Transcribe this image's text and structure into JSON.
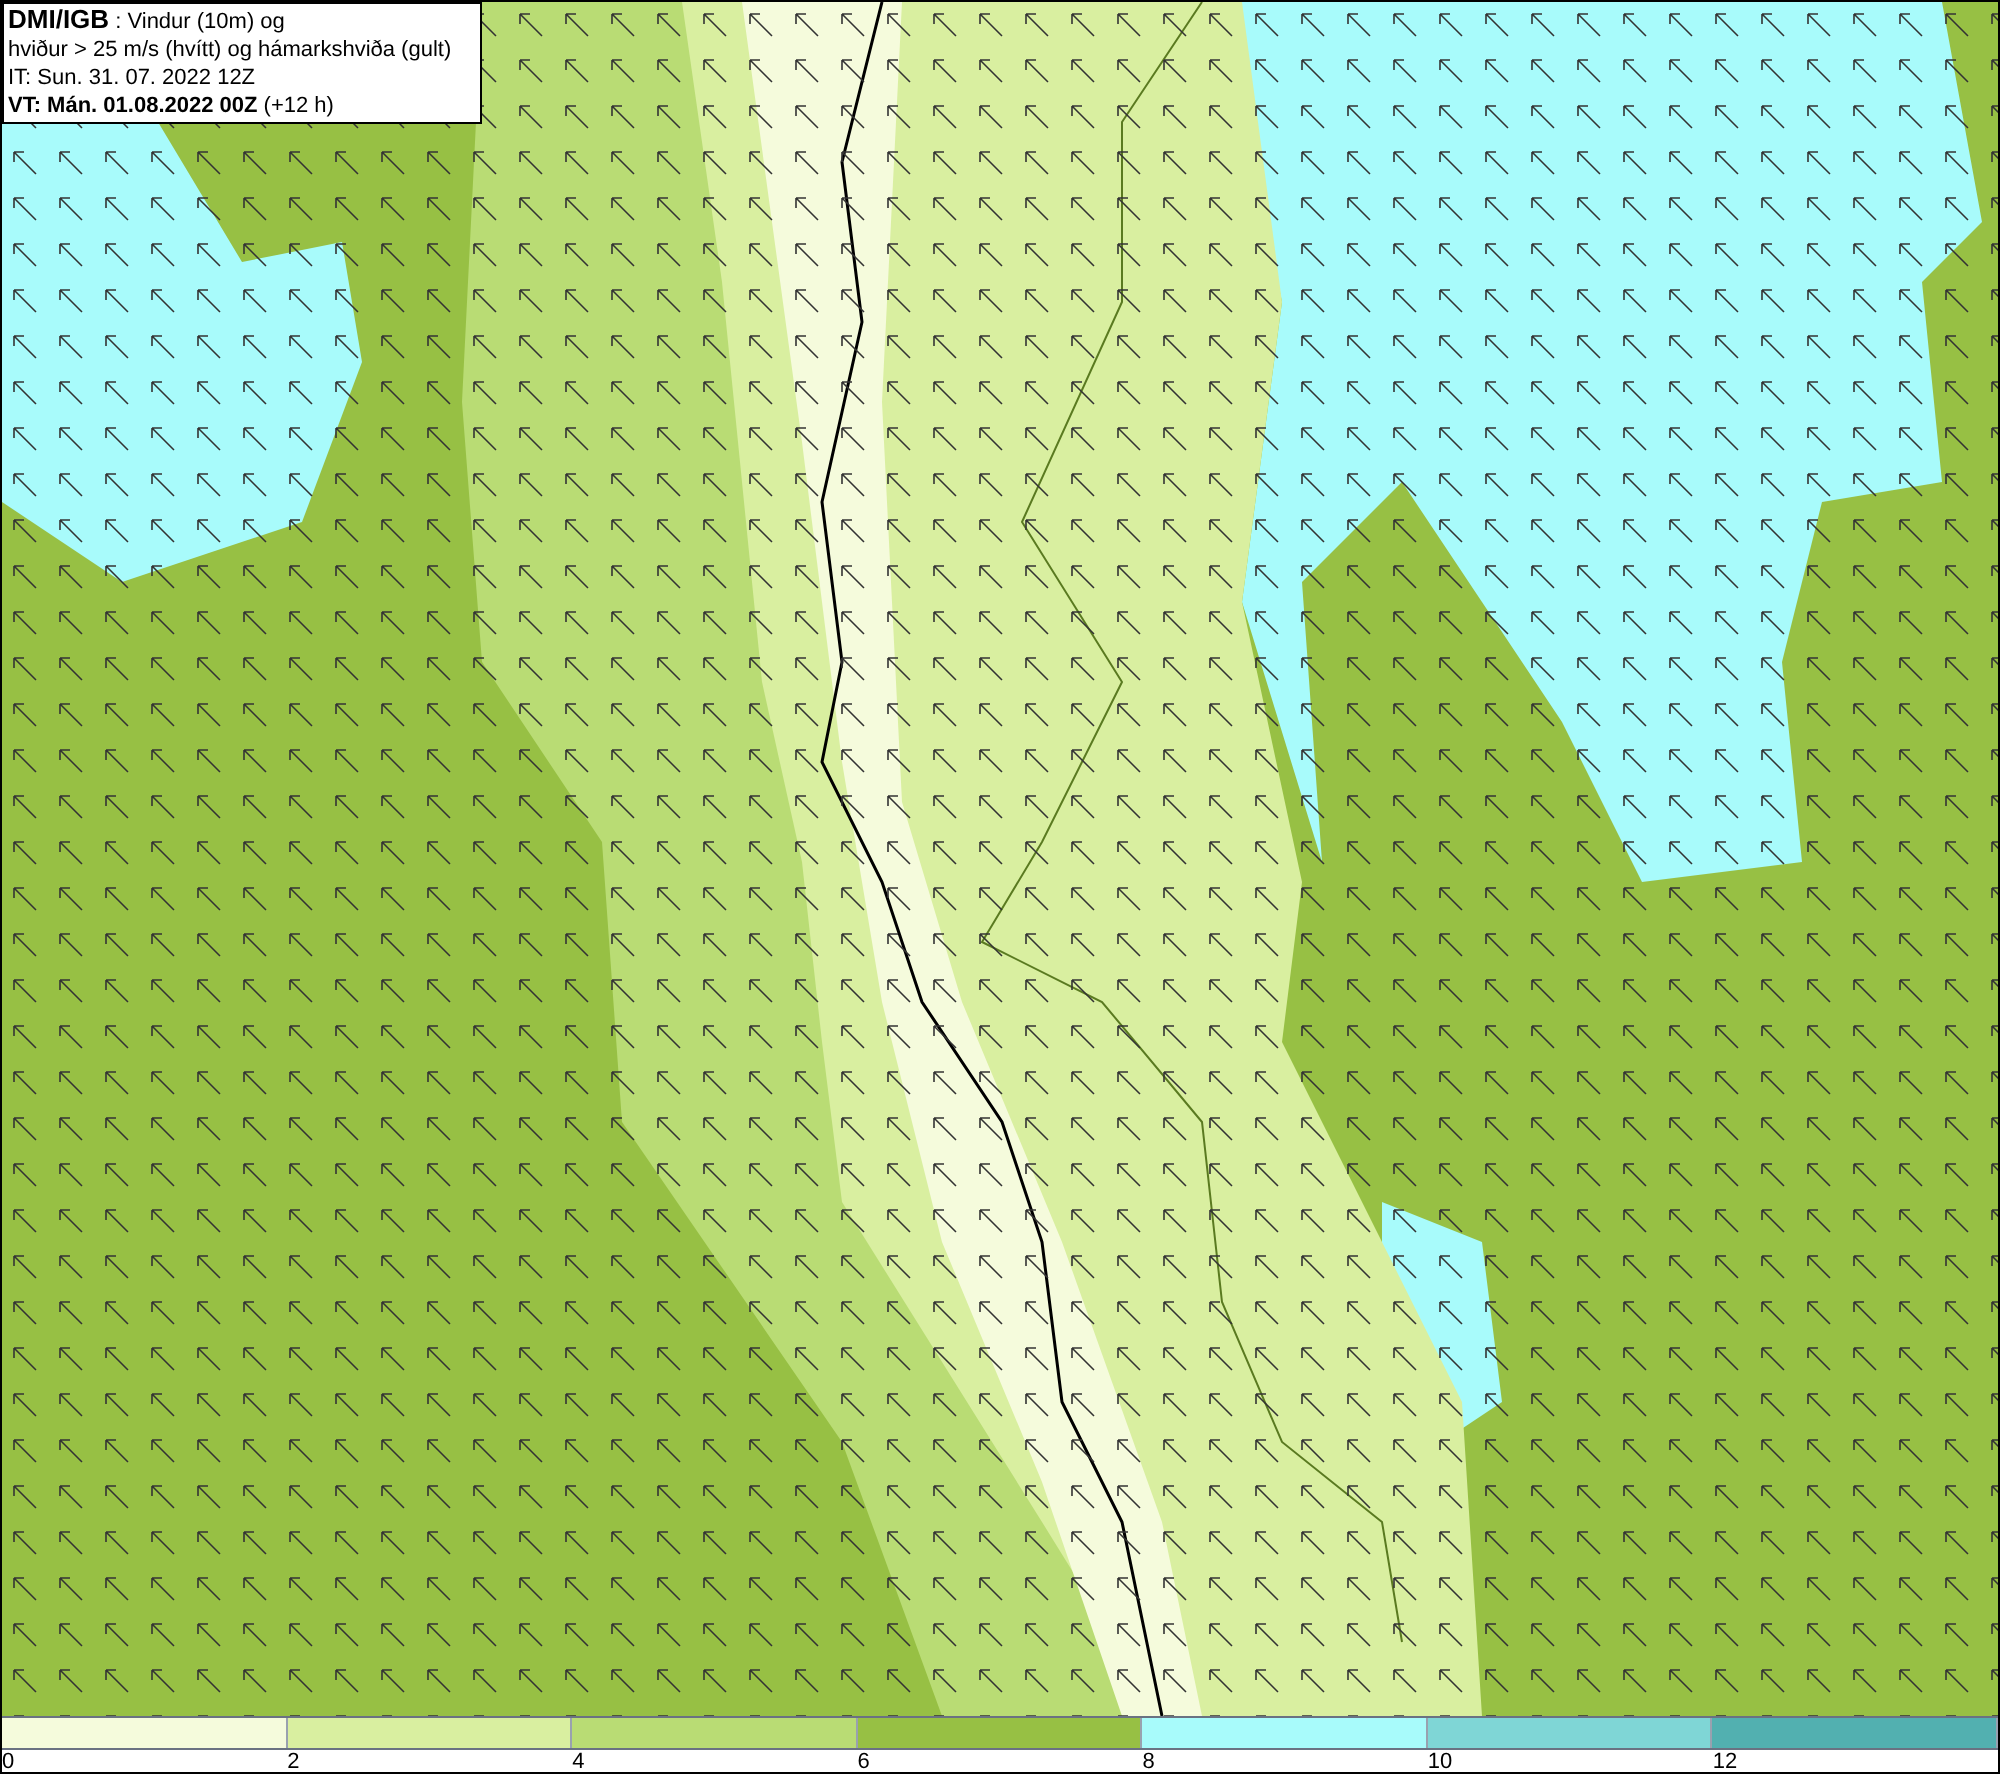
{
  "title_box": {
    "source": "DMI/IGB",
    "lines": [
      " : Vindur (10m) og",
      "hviður > 25 m/s (hvítt) og hámarkshviða (gult)",
      "IT: Sun. 31. 07. 2022 12Z"
    ],
    "valid_time": "VT: Mán. 01.08.2022 00Z",
    "lead": " (+12 h)"
  },
  "legend": {
    "bins": [
      {
        "color": "#f5fbdc"
      },
      {
        "color": "#d9efa0"
      },
      {
        "color": "#b9dc74"
      },
      {
        "color": "#97c044"
      },
      {
        "color": "#a8fbfb"
      },
      {
        "color": "#7fd6d6"
      },
      {
        "color": "#52b0b0"
      }
    ],
    "ticks": [
      "0",
      "2",
      "4",
      "6",
      "8",
      "10",
      "12"
    ]
  }
}
